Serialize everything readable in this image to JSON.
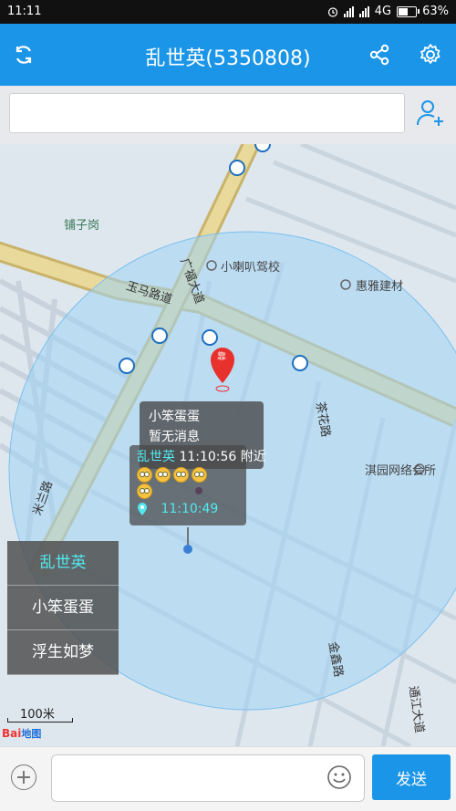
{
  "status_bar": {
    "time": "11:11",
    "network": "4G",
    "battery": "63%",
    "battery_level": 0.63
  },
  "header": {
    "title": "乱世英(5350808)",
    "refresh_icon": "refresh-icon",
    "share_icon": "share-icon",
    "settings_icon": "gear-icon"
  },
  "search": {
    "value": "",
    "placeholder": "",
    "add_user_icon": "add-user-icon"
  },
  "map": {
    "places": {
      "puzigang": "铺子岗",
      "driving_school": "小喇叭驾校",
      "building_materials": "惠雅建材",
      "internet_cafe": "淇园网络会所"
    },
    "roads": {
      "yuma": "玉马路道",
      "guangfu": "广福大道",
      "chahua": "茶花路",
      "miwei": "米兰路",
      "jinxin": "金鑫路",
      "tongjiang": "通江大道"
    },
    "marker_glyph": "靠",
    "popup_friend": {
      "name": "小笨蛋蛋",
      "message": "暂无消息"
    },
    "popup_self": {
      "name": "乱世英",
      "time": "11:10:56",
      "note": "附近",
      "pin_time": "11:10:49"
    },
    "scale_label": "100米",
    "logo_text": "Bai",
    "logo_text_2": "地图",
    "colors": {
      "accent": "#1b95e8",
      "range_circle": "#9fd3f5",
      "road": "#c9b36b",
      "active_user": "#52e8f0"
    }
  },
  "user_list": {
    "items": [
      {
        "label": "乱世英",
        "active": true
      },
      {
        "label": "小笨蛋蛋",
        "active": false
      },
      {
        "label": "浮生如梦",
        "active": false
      }
    ]
  },
  "composer": {
    "value": "",
    "placeholder": "",
    "send_label": "发送",
    "plus_icon": "plus-icon",
    "emoji_icon": "smiley-icon"
  }
}
